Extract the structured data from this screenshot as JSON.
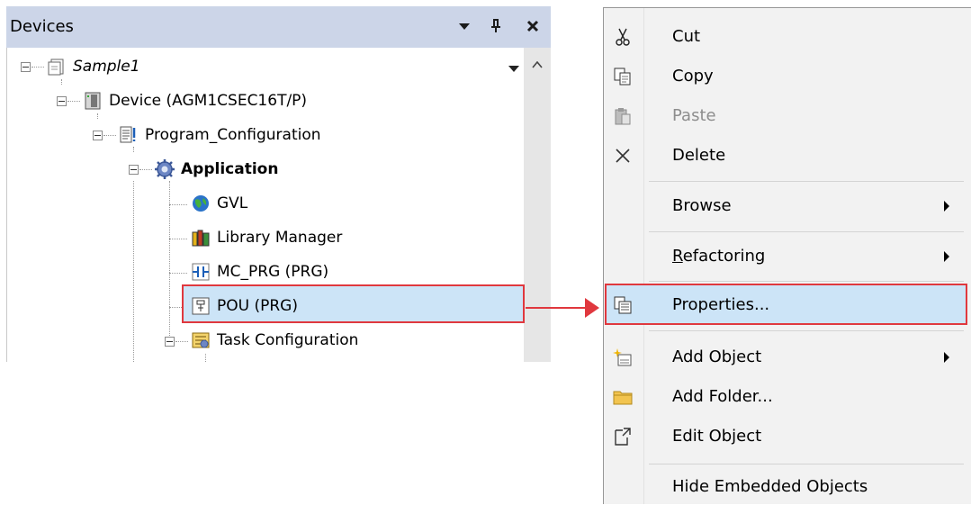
{
  "devices_panel": {
    "title": "Devices",
    "tree": {
      "sample": "Sample1",
      "device": "Device (AGM1CSEC16T/P)",
      "program_configuration": "Program_Configuration",
      "application": "Application",
      "gvl": "GVL",
      "library_manager": "Library Manager",
      "mc_prg": "MC_PRG (PRG)",
      "pou": "POU (PRG)",
      "task_configuration": "Task Configuration"
    }
  },
  "context_menu": {
    "items": [
      {
        "label": "Cut",
        "icon": "cut-icon"
      },
      {
        "label": "Copy",
        "icon": "copy-icon"
      },
      {
        "label": "Paste",
        "icon": "paste-icon",
        "disabled": true
      },
      {
        "label": "Delete",
        "icon": "delete-icon"
      },
      {
        "label": "Browse",
        "submenu": true
      },
      {
        "label": "Refactoring",
        "submenu": true
      },
      {
        "label": "Properties...",
        "icon": "properties-icon",
        "highlighted": true
      },
      {
        "label": "Add Object",
        "icon": "add-object-icon",
        "submenu": true
      },
      {
        "label": "Add Folder...",
        "icon": "folder-icon"
      },
      {
        "label": "Edit Object",
        "icon": "edit-object-icon"
      },
      {
        "label": "Hide Embedded Objects"
      }
    ]
  },
  "colors": {
    "highlight": "#cce4f7",
    "annotation_red": "#e0383e",
    "titlebar": "#ccd5e8"
  }
}
